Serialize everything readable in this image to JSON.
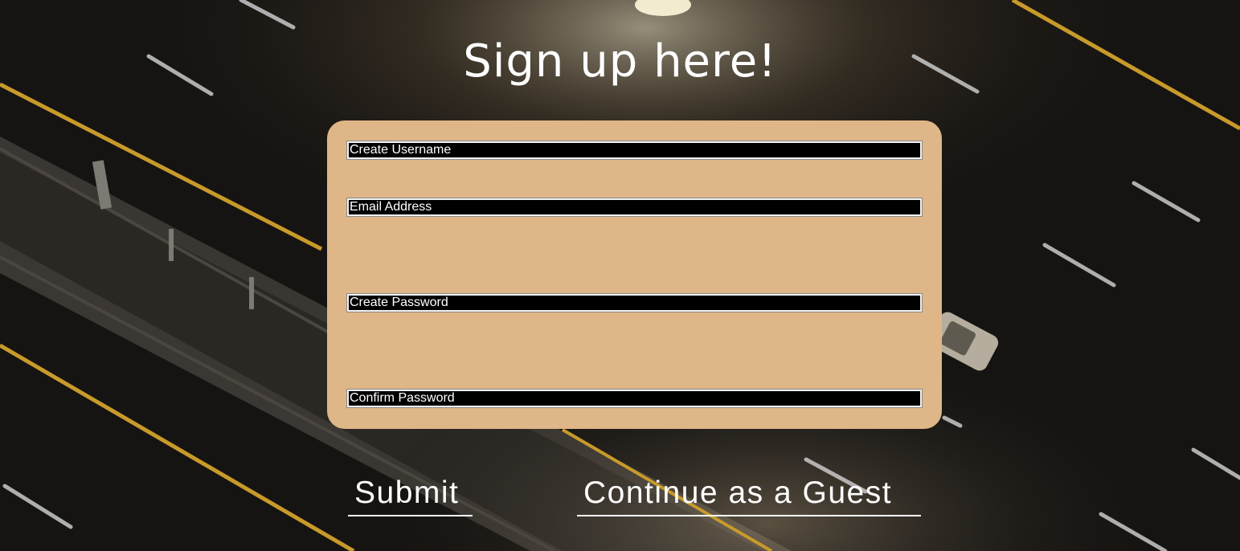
{
  "page": {
    "title": "Sign up here!"
  },
  "form": {
    "fields": [
      {
        "placeholder": "Create Username",
        "value": ""
      },
      {
        "placeholder": "Email Address",
        "value": ""
      },
      {
        "placeholder": "Create Password",
        "value": ""
      },
      {
        "placeholder": "Confirm Password",
        "value": ""
      }
    ],
    "card_color": "#deb687"
  },
  "actions": {
    "submit_label": "Submit",
    "guest_label": "Continue as a Guest"
  },
  "colors": {
    "text": "#ffffff",
    "field_background": "#000000",
    "background_road": "#141210",
    "lane_line_yellow": "#c89a2a"
  }
}
